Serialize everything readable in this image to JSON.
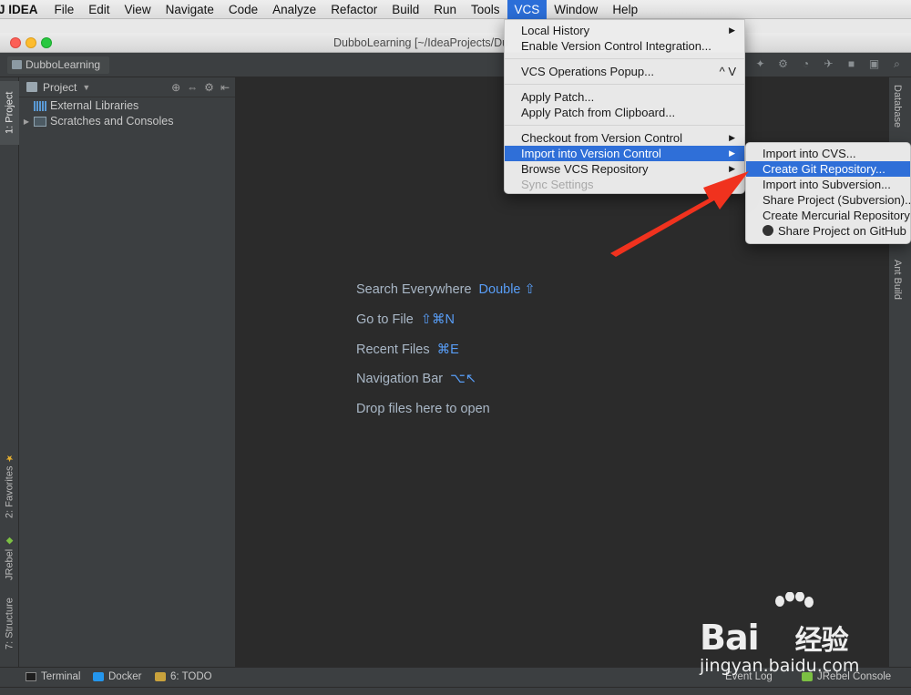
{
  "menubar": {
    "app_name": "J IDEA",
    "items": [
      "File",
      "Edit",
      "View",
      "Navigate",
      "Code",
      "Analyze",
      "Refactor",
      "Build",
      "Run",
      "Tools",
      "VCS",
      "Window",
      "Help"
    ],
    "active": "VCS"
  },
  "window": {
    "title": "DubboLearning [~/IdeaProjects/Du"
  },
  "navbar": {
    "breadcrumb": "DubboLearning"
  },
  "left_strip": {
    "project_tab": "1: Project",
    "favorites_tab": "2: Favorites",
    "jrebel_tab": "JRebel",
    "structure_tab": "7: Structure"
  },
  "project_pane": {
    "title": "Project",
    "nodes": [
      "External Libraries",
      "Scratches and Consoles"
    ]
  },
  "editor": {
    "hints": [
      {
        "label": "Search Everywhere",
        "shortcut": "Double ⇧"
      },
      {
        "label": "Go to File",
        "shortcut": "⇧⌘N"
      },
      {
        "label": "Recent Files",
        "shortcut": "⌘E"
      },
      {
        "label": "Navigation Bar",
        "shortcut": "⌥↖"
      },
      {
        "label": "Drop files here to open",
        "shortcut": ""
      }
    ]
  },
  "right_strip": {
    "database_tab": "Database",
    "ant_tab": "Ant Build"
  },
  "vcs_menu": {
    "local_history": "Local History",
    "enable_vc": "Enable Version Control Integration...",
    "ops_popup": "VCS Operations Popup...",
    "ops_popup_key": "^ V",
    "apply_patch": "Apply Patch...",
    "apply_patch_clip": "Apply Patch from Clipboard...",
    "checkout": "Checkout from Version Control",
    "import_vc": "Import into Version Control",
    "browse": "Browse VCS Repository",
    "sync": "Sync Settings"
  },
  "import_submenu": {
    "cvs": "Import into CVS...",
    "git": "Create Git Repository...",
    "svn": "Import into Subversion...",
    "share_svn": "Share Project (Subversion)...",
    "hg": "Create Mercurial Repository",
    "github": "Share Project on GitHub"
  },
  "bottom_bar": {
    "terminal": "Terminal",
    "docker": "Docker",
    "todo": "6: TODO",
    "event_log": "Event Log",
    "jrebel_console": "JRebel Console"
  },
  "watermark": {
    "brand_latin": "Bai",
    "brand_cn": "经验",
    "url": "jingyan.baidu.com"
  },
  "colors": {
    "menu_highlight": "#2f6fd8",
    "editor_bg": "#2b2b2b",
    "shortcut_blue": "#589df6",
    "arrow_red": "#f0321e"
  }
}
